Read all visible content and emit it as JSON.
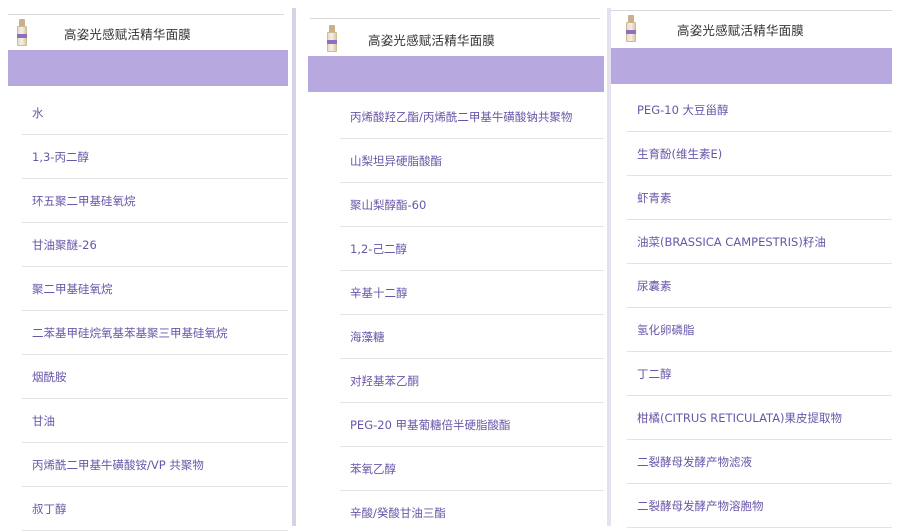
{
  "header": {
    "title": "高姿光感赋活精华面膜"
  },
  "colors": {
    "accent_band": "#b8a8e0",
    "text": "#6a56a8",
    "divider": "#5c4b8c"
  },
  "panels": [
    {
      "items": [
        "水",
        "1,3-丙二醇",
        "环五聚二甲基硅氧烷",
        "甘油聚醚-26",
        "聚二甲基硅氧烷",
        "二苯基甲硅烷氧基苯基聚三甲基硅氧烷",
        "烟酰胺",
        "甘油",
        "丙烯酰二甲基牛磺酸铵/VP 共聚物",
        "叔丁醇"
      ]
    },
    {
      "items": [
        "丙烯酸羟乙酯/丙烯酰二甲基牛磺酸钠共聚物",
        "山梨坦异硬脂酸酯",
        "聚山梨醇酯-60",
        "1,2-己二醇",
        "辛基十二醇",
        "海藻糖",
        "对羟基苯乙酮",
        "PEG-20 甲基葡糖倍半硬脂酸酯",
        "苯氧乙醇",
        "辛酸/癸酸甘油三酯"
      ]
    },
    {
      "items": [
        "PEG-10 大豆甾醇",
        "生育酚(维生素E)",
        "虾青素",
        "油菜(BRASSICA CAMPESTRIS)籽油",
        "尿囊素",
        "氢化卵磷脂",
        "丁二醇",
        "柑橘(CITRUS RETICULATA)果皮提取物",
        "二裂酵母发酵产物滤液",
        "二裂酵母发酵产物溶胞物"
      ]
    }
  ]
}
